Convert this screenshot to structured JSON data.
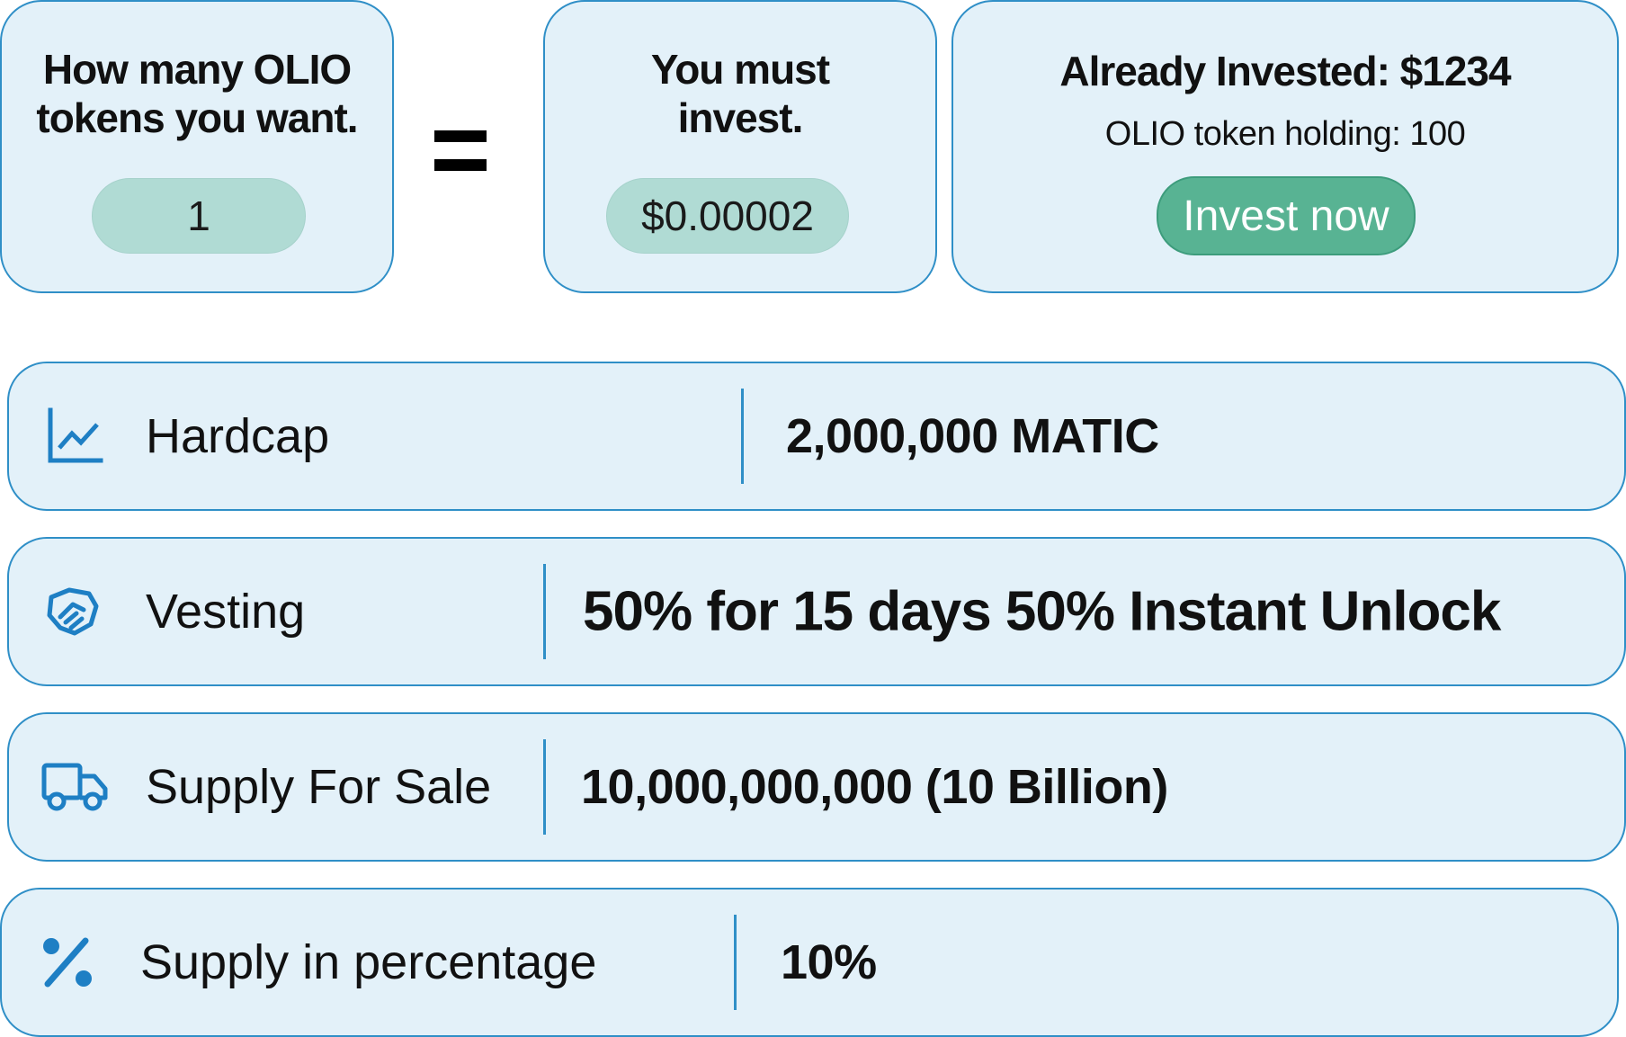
{
  "calculator": {
    "tokens_card": {
      "title_line1": "How many OLIO",
      "title_line2": "tokens you want.",
      "token_input_value": "1"
    },
    "equals_symbol": "=",
    "invest_card": {
      "title_line1": "You must",
      "title_line2": "invest.",
      "amount": "$0.00002"
    },
    "status_card": {
      "already_invested": "Already Invested: $1234",
      "holding": "OLIO token holding: 100",
      "invest_button_label": "Invest now"
    }
  },
  "details": [
    {
      "icon": "line-chart-icon",
      "label": "Hardcap",
      "value": "2,000,000 MATIC"
    },
    {
      "icon": "handshake-icon",
      "label": "Vesting",
      "value": "50% for 15 days 50% Instant Unlock"
    },
    {
      "icon": "truck-icon",
      "label": "Supply For Sale",
      "value": "10,000,000,000 (10 Billion)"
    },
    {
      "icon": "percent-icon",
      "label": "Supply in percentage",
      "value": "10%"
    }
  ],
  "colors": {
    "card_background": "#e3f1f9",
    "card_border": "#2f8fc7",
    "icon_blue": "#1e7fc4",
    "input_pill": "#b0dbd4",
    "invest_button": "#58b393"
  }
}
